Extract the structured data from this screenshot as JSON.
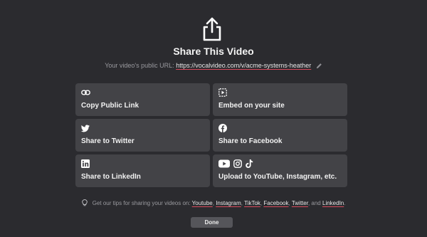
{
  "modal": {
    "title": "Share This Video",
    "url_label": "Your video's public URL:",
    "url": "https://vocalvideo.com/v/acme-systems-heather"
  },
  "cards": {
    "copy_link": {
      "label": "Copy Public Link",
      "icons": [
        "link-icon"
      ]
    },
    "embed": {
      "label": "Embed on your site",
      "icons": [
        "embed-icon"
      ]
    },
    "twitter": {
      "label": "Share to Twitter",
      "icons": [
        "twitter-icon"
      ]
    },
    "facebook": {
      "label": "Share to Facebook",
      "icons": [
        "facebook-icon"
      ]
    },
    "linkedin": {
      "label": "Share to LinkedIn",
      "icons": [
        "linkedin-icon"
      ]
    },
    "upload": {
      "label": "Upload to YouTube, Instagram, etc.",
      "icons": [
        "youtube-icon",
        "instagram-icon",
        "tiktok-icon"
      ]
    }
  },
  "tips": {
    "prefix": "Get our tips for sharing your videos on:",
    "links": [
      "Youtube",
      "Instagram",
      "TikTok",
      "Facebook",
      "Twitter",
      "LinkedIn"
    ],
    "and": "and",
    "period": "."
  },
  "done_label": "Done",
  "colors": {
    "background": "#2b2b2f",
    "card": "#434347",
    "underline_accent": "#d94a5c",
    "done_button": "#55555a"
  }
}
